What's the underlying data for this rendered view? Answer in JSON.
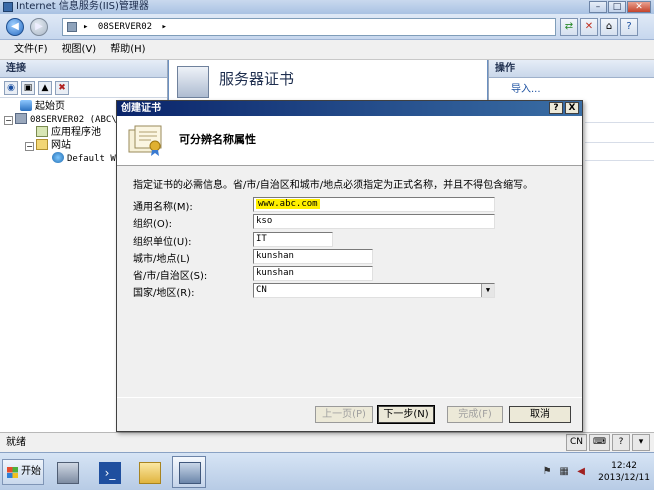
{
  "window": {
    "title": "Internet 信息服务(IIS)管理器"
  },
  "addressbar": {
    "path": "08SERVER02",
    "separator": "▸"
  },
  "menu": {
    "items": [
      "文件(F)",
      "视图(V)",
      "帮助(H)"
    ]
  },
  "connections": {
    "header": "连接",
    "tree": {
      "start_page": "起始页",
      "server": "08SERVER02 (ABC\\",
      "app_pools": "应用程序池",
      "sites": "网站",
      "default_site": "Default We"
    }
  },
  "center": {
    "title": "服务器证书"
  },
  "actions": {
    "header": "操作",
    "import": "导入..."
  },
  "status": {
    "text": "就绪",
    "lang": "CN"
  },
  "dialog": {
    "title": "创建证书",
    "help_btn": "?",
    "close_btn": "X",
    "header_title": "可分辨名称属性",
    "instruction": "指定证书的必需信息。省/市/自治区和城市/地点必须指定为正式名称，并且不得包含缩写。",
    "fields": {
      "common_name": {
        "label": "通用名称(M):",
        "value": "www.abc.com"
      },
      "organization": {
        "label": "组织(O):",
        "value": "kso"
      },
      "org_unit": {
        "label": "组织单位(U):",
        "value": "IT"
      },
      "city": {
        "label": "城市/地点(L)",
        "value": "kunshan"
      },
      "state": {
        "label": "省/市/自治区(S):",
        "value": "kunshan"
      },
      "country": {
        "label": "国家/地区(R):",
        "value": "CN"
      }
    },
    "buttons": {
      "prev": "上一页(P)",
      "next": "下一步(N)",
      "finish": "完成(F)",
      "cancel": "取消"
    }
  },
  "taskbar": {
    "start": "开始"
  },
  "clock": {
    "time": "12:42",
    "date": "2013/12/11"
  }
}
